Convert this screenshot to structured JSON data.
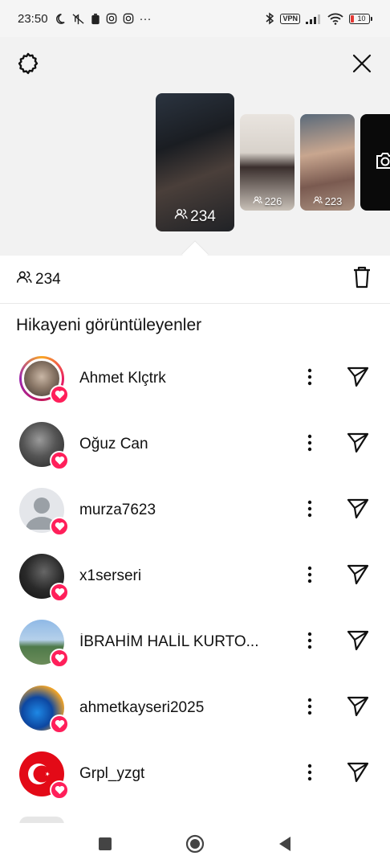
{
  "status_bar": {
    "time": "23:50",
    "more": "···",
    "vpn": "VPN",
    "battery_level": "10"
  },
  "story": {
    "thumbnails": [
      {
        "count": "234",
        "selected": true
      },
      {
        "count": "226"
      },
      {
        "count": "223"
      }
    ]
  },
  "viewers_count": "234",
  "section_title": "Hikayeni görüntüleyenler",
  "viewers": [
    {
      "name": "Ahmet Klçtrk",
      "liked": true
    },
    {
      "name": "Oğuz Can",
      "liked": true
    },
    {
      "name": "murza7623",
      "liked": true
    },
    {
      "name": "x1serseri",
      "liked": true
    },
    {
      "name": "İBRAHİM HALİL KURTO...",
      "liked": true
    },
    {
      "name": "ahmetkayseri2025",
      "liked": true
    },
    {
      "name": "Grpl_yzgt",
      "liked": true
    }
  ],
  "colors": {
    "like_badge": "#ff1f5a",
    "background": "#ffffff",
    "panel": "#f2f2f2"
  },
  "icons": [
    "settings-icon",
    "close-icon",
    "viewers-icon",
    "trash-icon",
    "more-options-icon",
    "send-icon",
    "heart-icon",
    "camera-icon"
  ]
}
